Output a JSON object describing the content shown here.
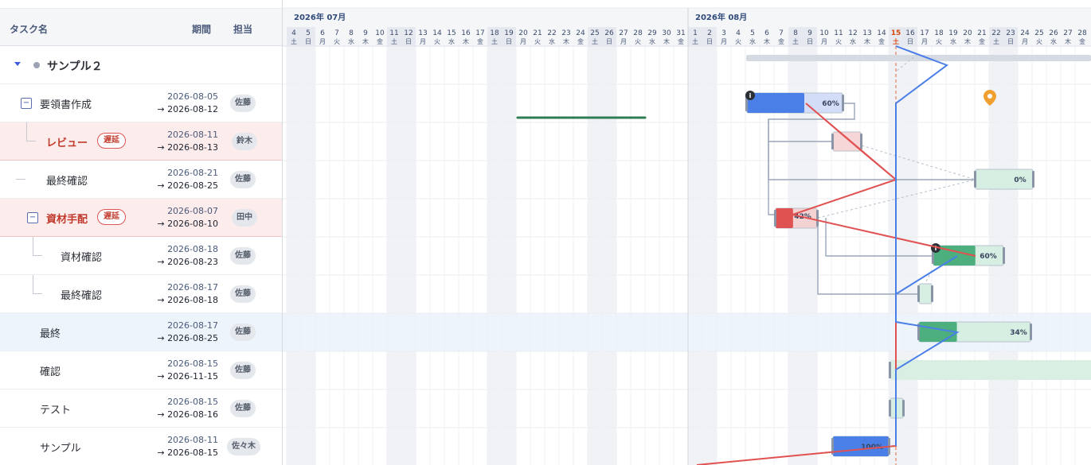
{
  "header": {
    "task_name_label": "タスク名",
    "period_label": "期間",
    "assignee_label": "担当"
  },
  "timeline": {
    "months": [
      {
        "label": "2026年 07月",
        "start_day_index": 0
      },
      {
        "label": "2026年 08月",
        "start_day_index": 28
      }
    ],
    "days": [
      {
        "d": "4",
        "w": "土"
      },
      {
        "d": "5",
        "w": "日"
      },
      {
        "d": "6",
        "w": "月"
      },
      {
        "d": "7",
        "w": "火"
      },
      {
        "d": "8",
        "w": "水"
      },
      {
        "d": "9",
        "w": "木"
      },
      {
        "d": "10",
        "w": "金"
      },
      {
        "d": "11",
        "w": "土"
      },
      {
        "d": "12",
        "w": "日"
      },
      {
        "d": "13",
        "w": "月"
      },
      {
        "d": "14",
        "w": "火"
      },
      {
        "d": "15",
        "w": "水"
      },
      {
        "d": "16",
        "w": "木"
      },
      {
        "d": "17",
        "w": "金"
      },
      {
        "d": "18",
        "w": "土"
      },
      {
        "d": "19",
        "w": "日"
      },
      {
        "d": "20",
        "w": "月"
      },
      {
        "d": "21",
        "w": "火"
      },
      {
        "d": "22",
        "w": "水"
      },
      {
        "d": "23",
        "w": "木"
      },
      {
        "d": "24",
        "w": "金"
      },
      {
        "d": "25",
        "w": "土"
      },
      {
        "d": "26",
        "w": "日"
      },
      {
        "d": "27",
        "w": "月"
      },
      {
        "d": "28",
        "w": "火"
      },
      {
        "d": "29",
        "w": "水"
      },
      {
        "d": "30",
        "w": "木"
      },
      {
        "d": "31",
        "w": "金"
      },
      {
        "d": "1",
        "w": "土"
      },
      {
        "d": "2",
        "w": "日"
      },
      {
        "d": "3",
        "w": "月"
      },
      {
        "d": "4",
        "w": "火"
      },
      {
        "d": "5",
        "w": "水"
      },
      {
        "d": "6",
        "w": "木"
      },
      {
        "d": "7",
        "w": "金"
      },
      {
        "d": "8",
        "w": "土"
      },
      {
        "d": "9",
        "w": "日"
      },
      {
        "d": "10",
        "w": "月"
      },
      {
        "d": "11",
        "w": "火"
      },
      {
        "d": "12",
        "w": "水"
      },
      {
        "d": "13",
        "w": "木"
      },
      {
        "d": "14",
        "w": "金"
      },
      {
        "d": "15",
        "w": "土"
      },
      {
        "d": "16",
        "w": "日"
      },
      {
        "d": "17",
        "w": "月"
      },
      {
        "d": "18",
        "w": "火"
      },
      {
        "d": "19",
        "w": "水"
      },
      {
        "d": "20",
        "w": "木"
      },
      {
        "d": "21",
        "w": "金"
      },
      {
        "d": "22",
        "w": "土"
      },
      {
        "d": "23",
        "w": "日"
      },
      {
        "d": "24",
        "w": "月"
      },
      {
        "d": "25",
        "w": "火"
      },
      {
        "d": "26",
        "w": "水"
      },
      {
        "d": "27",
        "w": "木"
      },
      {
        "d": "28",
        "w": "金"
      }
    ],
    "today_index": 42
  },
  "tasks": [
    {
      "name": "サンプル２",
      "kind": "project"
    },
    {
      "name": "要領書作成",
      "start": "2026-08-05",
      "end": "→ 2026-08-12",
      "assignee": "佐藤",
      "progress": "60%"
    },
    {
      "name": "レビュー",
      "badge": "遅延",
      "start": "2026-08-11",
      "end": "→ 2026-08-13",
      "assignee": "鈴木"
    },
    {
      "name": "最終確認",
      "start": "2026-08-21",
      "end": "→ 2026-08-25",
      "assignee": "佐藤",
      "progress": "0%"
    },
    {
      "name": "資材手配",
      "badge": "遅延",
      "start": "2026-08-07",
      "end": "→ 2026-08-10",
      "assignee": "田中",
      "progress": "42%"
    },
    {
      "name": "資材確認",
      "start": "2026-08-18",
      "end": "→ 2026-08-23",
      "assignee": "佐藤",
      "progress": "60%"
    },
    {
      "name": "最終確認",
      "start": "2026-08-17",
      "end": "→ 2026-08-18",
      "assignee": "佐藤"
    },
    {
      "name": "最終",
      "start": "2026-08-17",
      "end": "→ 2026-08-25",
      "assignee": "佐藤",
      "progress": "34%"
    },
    {
      "name": "確認",
      "start": "2026-08-15",
      "end": "→ 2026-11-15",
      "assignee": "佐藤"
    },
    {
      "name": "テスト",
      "start": "2026-08-15",
      "end": "→ 2026-08-16",
      "assignee": "佐藤"
    },
    {
      "name": "サンプル",
      "start": "2026-08-11",
      "end": "→ 2026-08-15",
      "assignee": "佐々木",
      "progress": "100%"
    }
  ],
  "colors": {
    "blue_bar": "#4a7fe8",
    "green_bar": "#4caf7d",
    "red_bar": "#e05252",
    "late_row": "#fdecec",
    "selected_row": "#eef4fc",
    "weekend": "#f1f2f6",
    "today_line": "#d9480f",
    "marker": "#f0a030"
  },
  "icons": {
    "info": "info-icon",
    "marker": "map-pin-icon",
    "collapse": "minus-square-icon",
    "expand": "caret-down-icon"
  }
}
